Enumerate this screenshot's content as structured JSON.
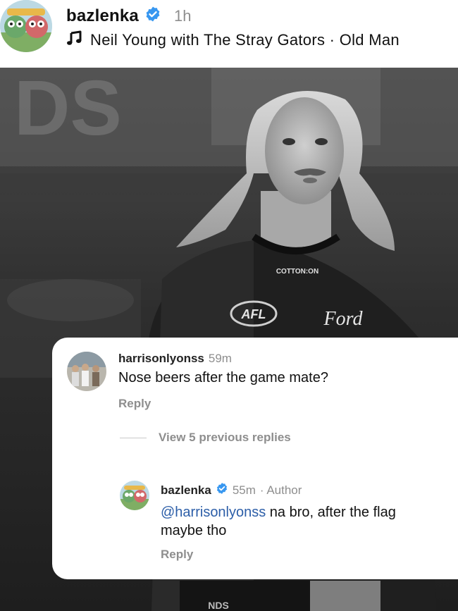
{
  "post": {
    "username": "bazlenka",
    "time": "1h",
    "music": "Neil Young with The Stray Gators · Old Man"
  },
  "photo": {
    "shirt_brand": "COTTON:ON",
    "sponsor": "Ford",
    "league": "AFL",
    "pants_text": "NDS"
  },
  "comments": {
    "first": {
      "username": "harrisonlyonss",
      "time": "59m",
      "text": "Nose beers after the game mate?",
      "reply_label": "Reply"
    },
    "view_replies": "View 5 previous replies",
    "second": {
      "username": "bazlenka",
      "time": "55m",
      "author_tag": "· Author",
      "mention": "@harrisonlyonss",
      "text": " na bro, after the flag",
      "text_line2": "maybe tho",
      "reply_label": "Reply"
    }
  },
  "colors": {
    "verified": "#3797f0",
    "mention": "#2c5ea8",
    "meta": "#8e8e8e"
  }
}
